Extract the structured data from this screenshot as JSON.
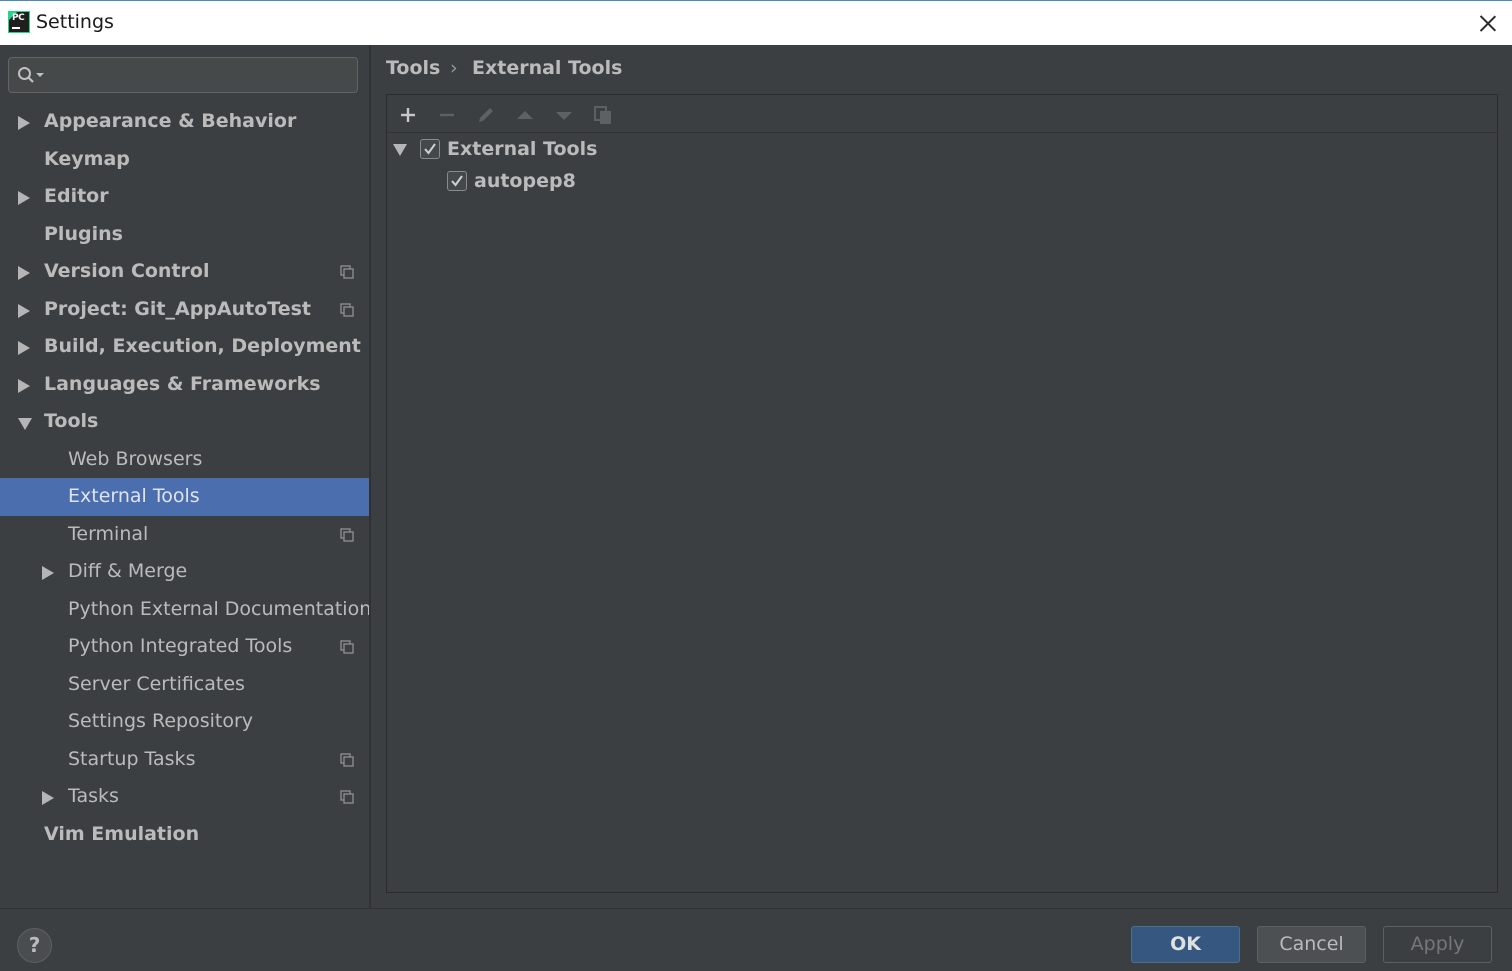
{
  "window": {
    "title": "Settings",
    "app_icon_text": "PC"
  },
  "search": {
    "placeholder": "",
    "value": ""
  },
  "sidebar": {
    "items": [
      {
        "label": "Appearance & Behavior",
        "arrow": "right",
        "bold": true,
        "project_icon": false
      },
      {
        "label": "Keymap",
        "arrow": "none",
        "bold": true,
        "project_icon": false
      },
      {
        "label": "Editor",
        "arrow": "right",
        "bold": true,
        "project_icon": false
      },
      {
        "label": "Plugins",
        "arrow": "none",
        "bold": true,
        "project_icon": false
      },
      {
        "label": "Version Control",
        "arrow": "right",
        "bold": true,
        "project_icon": true
      },
      {
        "label": "Project: Git_AppAutoTest",
        "arrow": "right",
        "bold": true,
        "project_icon": true
      },
      {
        "label": "Build, Execution, Deployment",
        "arrow": "right",
        "bold": true,
        "project_icon": false
      },
      {
        "label": "Languages & Frameworks",
        "arrow": "right",
        "bold": true,
        "project_icon": false
      },
      {
        "label": "Tools",
        "arrow": "down",
        "bold": true,
        "project_icon": false
      },
      {
        "label": "Web Browsers",
        "arrow": "none",
        "bold": false,
        "project_icon": false
      },
      {
        "label": "External Tools",
        "arrow": "none",
        "bold": false,
        "project_icon": false,
        "selected": true
      },
      {
        "label": "Terminal",
        "arrow": "none",
        "bold": false,
        "project_icon": true
      },
      {
        "label": "Diff & Merge",
        "arrow": "right",
        "bold": false,
        "project_icon": false
      },
      {
        "label": "Python External Documentation",
        "arrow": "none",
        "bold": false,
        "project_icon": false
      },
      {
        "label": "Python Integrated Tools",
        "arrow": "none",
        "bold": false,
        "project_icon": true
      },
      {
        "label": "Server Certificates",
        "arrow": "none",
        "bold": false,
        "project_icon": false
      },
      {
        "label": "Settings Repository",
        "arrow": "none",
        "bold": false,
        "project_icon": false
      },
      {
        "label": "Startup Tasks",
        "arrow": "none",
        "bold": false,
        "project_icon": true
      },
      {
        "label": "Tasks",
        "arrow": "right",
        "bold": false,
        "project_icon": true
      },
      {
        "label": "Vim Emulation",
        "arrow": "none",
        "bold": true,
        "project_icon": false
      }
    ]
  },
  "breadcrumb": {
    "parent": "Tools",
    "separator": "›",
    "current": "External Tools"
  },
  "toolbar": {
    "buttons": [
      {
        "icon": "plus-icon",
        "enabled": true
      },
      {
        "icon": "minus-icon",
        "enabled": false
      },
      {
        "icon": "pencil-icon",
        "enabled": false
      },
      {
        "icon": "move-up-icon",
        "enabled": false
      },
      {
        "icon": "move-down-icon",
        "enabled": false
      },
      {
        "icon": "copy-icon",
        "enabled": false
      }
    ]
  },
  "tools_tree": {
    "group": {
      "label": "External Tools",
      "checked": true,
      "expanded": true
    },
    "children": [
      {
        "label": "autopep8",
        "checked": true
      }
    ]
  },
  "buttons": {
    "help": "?",
    "ok": "OK",
    "cancel": "Cancel",
    "apply": "Apply"
  },
  "colors": {
    "background": "#3c3f41",
    "selection": "#4b6eaf",
    "ok_button": "#365880",
    "text": "#bbbbbb"
  }
}
